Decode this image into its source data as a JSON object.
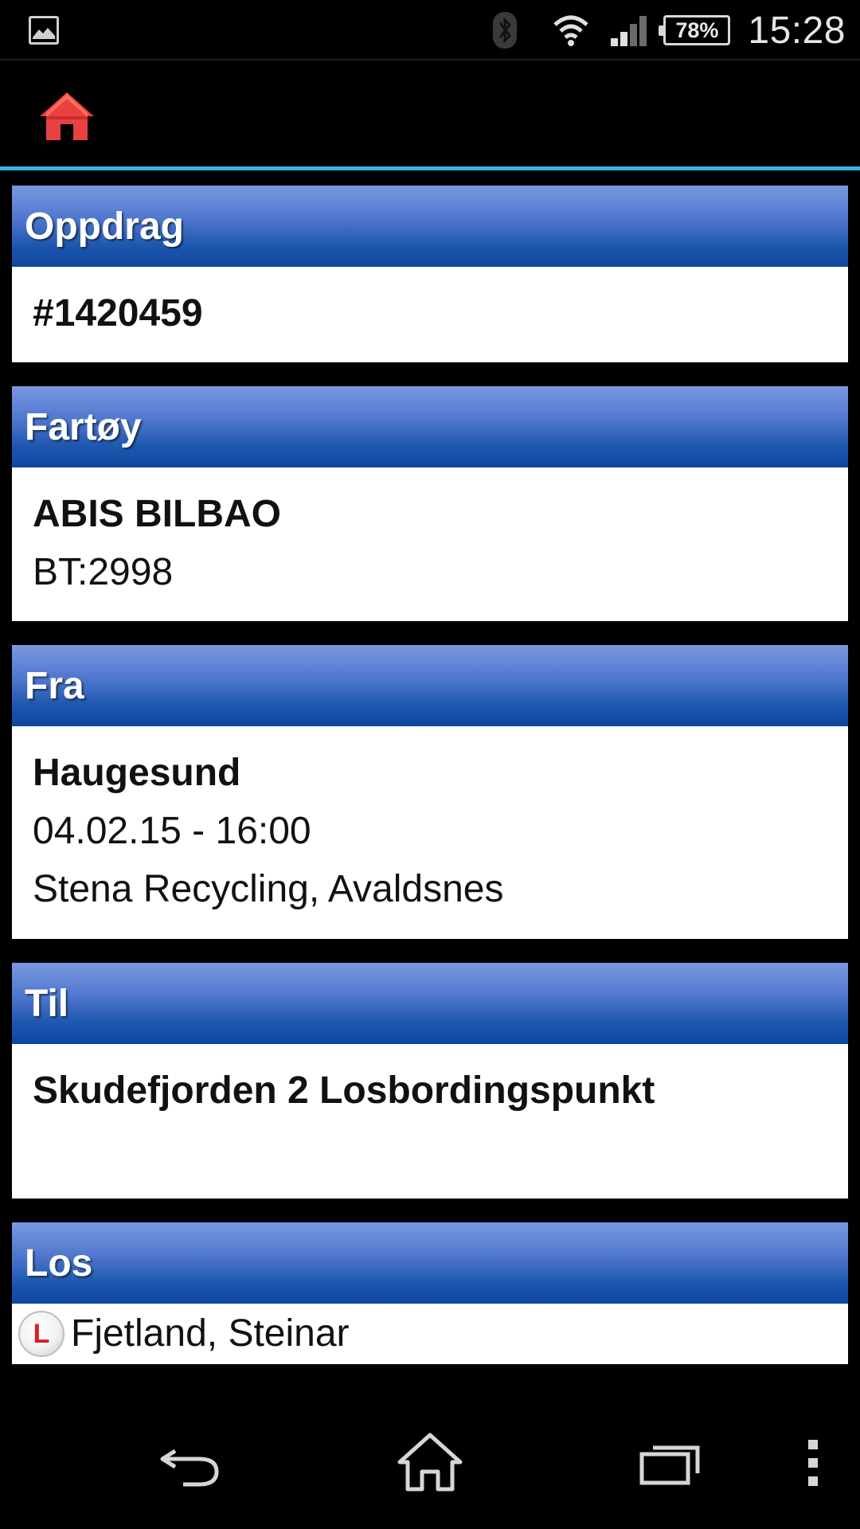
{
  "status_bar": {
    "time": "15:28",
    "battery_percent": "78%",
    "icons": [
      "gallery-icon",
      "bluetooth-icon",
      "wifi-icon",
      "signal-icon",
      "battery-icon"
    ]
  },
  "action_bar": {
    "home_icon": "home-icon",
    "accent_color": "#e8413f",
    "divider_color": "#33b5e5"
  },
  "sections": {
    "oppdrag": {
      "header": "Oppdrag",
      "value": "#1420459"
    },
    "fartoy": {
      "header": "Fartøy",
      "name": "ABIS BILBAO",
      "bt": "BT:2998"
    },
    "fra": {
      "header": "Fra",
      "location": "Haugesund",
      "datetime": "04.02.15 - 16:00",
      "place": "Stena Recycling, Avaldsnes"
    },
    "til": {
      "header": "Til",
      "location": "Skudefjorden 2 Losbordingspunkt"
    },
    "los": {
      "header": "Los",
      "badge": "L",
      "name": "Fjetland, Steinar"
    }
  },
  "header_gradient": [
    "#7b98e0",
    "#0c47a0"
  ],
  "nav_bar": {
    "buttons": [
      "back-icon",
      "home-icon",
      "recent-apps-icon",
      "menu-icon"
    ]
  }
}
